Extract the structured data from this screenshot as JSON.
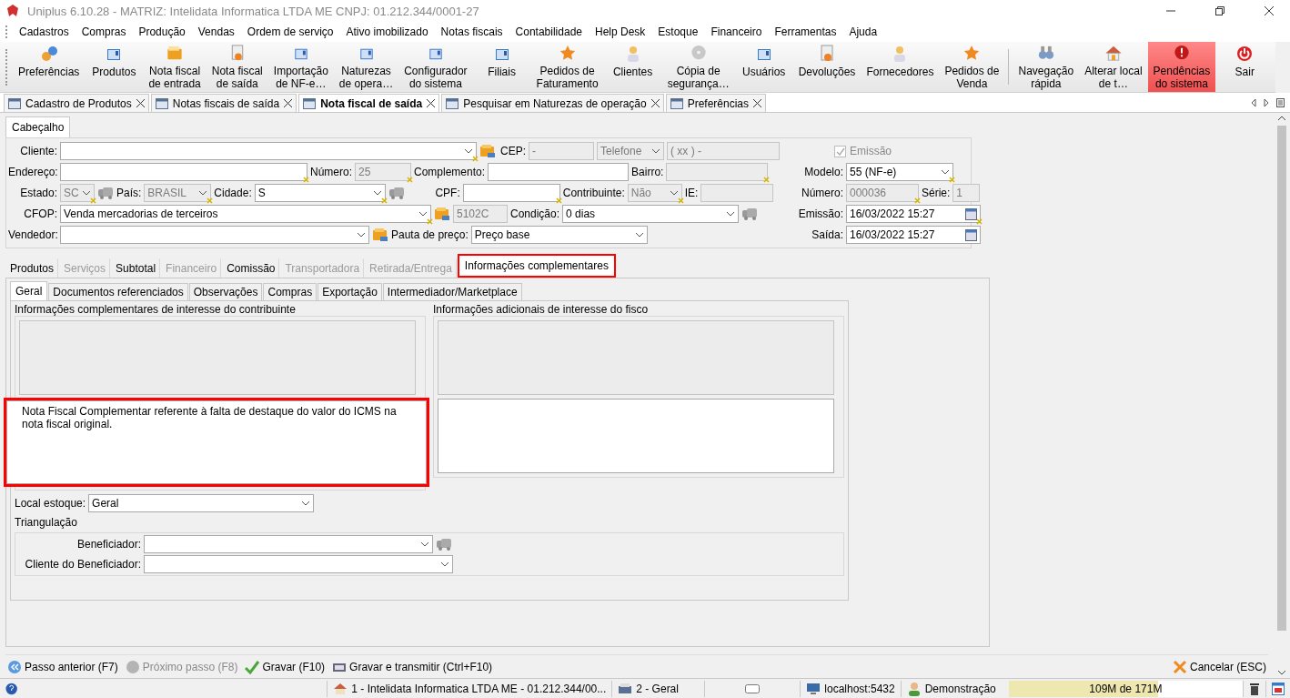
{
  "window": {
    "title": "Uniplus 6.10.28 - MATRIZ: Intelidata Informatica LTDA ME CNPJ: 01.212.344/0001-27"
  },
  "menu": [
    "Cadastros",
    "Compras",
    "Produção",
    "Vendas",
    "Ordem de serviço",
    "Ativo imobilizado",
    "Notas fiscais",
    "Contabilidade",
    "Help Desk",
    "Estoque",
    "Financeiro",
    "Ferramentas",
    "Ajuda"
  ],
  "toolbar": [
    [
      {
        "label": "Preferências",
        "kind": "gear"
      },
      {
        "label": "Produtos",
        "kind": "window"
      },
      {
        "label": "Nota fiscal\nde entrada",
        "kind": "folder"
      },
      {
        "label": "Nota fiscal\nde saída",
        "kind": "document"
      },
      {
        "label": "Importação\nde NF-e…",
        "kind": "window"
      },
      {
        "label": "Naturezas\nde opera…",
        "kind": "window"
      },
      {
        "label": "Configurador\ndo sistema",
        "kind": "window"
      },
      {
        "label": "Filiais",
        "kind": "window"
      },
      {
        "label": "Pedidos de\nFaturamento",
        "kind": "star"
      },
      {
        "label": "Clientes",
        "kind": "person"
      },
      {
        "label": "Cópia de\nsegurança…",
        "kind": "disc"
      },
      {
        "label": "Usuários",
        "kind": "window"
      },
      {
        "label": "Devoluções",
        "kind": "document"
      },
      {
        "label": "Fornecedores",
        "kind": "person"
      },
      {
        "label": "Pedidos de\nVenda",
        "kind": "star"
      }
    ],
    [
      {
        "label": "Navegação\nrápida",
        "kind": "binoculars"
      },
      {
        "label": "Alterar local\nde t…",
        "kind": "house"
      },
      {
        "label": "Pendências\ndo sistema",
        "kind": "alert"
      },
      {
        "label": "Sair",
        "kind": "power"
      }
    ]
  ],
  "doc_tabs": [
    {
      "label": "Cadastro de Produtos",
      "selected": false
    },
    {
      "label": "Notas fiscais de saída",
      "selected": false
    },
    {
      "label": "Nota fiscal de saída",
      "selected": true
    },
    {
      "label": "Pesquisar em Naturezas de operação",
      "selected": false
    },
    {
      "label": "Preferências",
      "selected": false
    }
  ],
  "header": {
    "tab": "Cabeçalho",
    "rows": [
      {
        "left": [
          {
            "kind": "label",
            "text": "Cliente:"
          },
          {
            "kind": "combo",
            "required": true
          },
          {
            "kind": "card"
          },
          {
            "kind": "label",
            "text": "CEP:"
          },
          {
            "kind": "text",
            "value": "-",
            "disabled": true
          },
          {
            "kind": "combo",
            "value": "Telefone",
            "disabled": true
          },
          {
            "kind": "text",
            "value": "( xx )   -",
            "disabled": true
          }
        ],
        "right": [
          {
            "kind": "checkbox",
            "text": "Emissão",
            "checked": true,
            "disabled": true
          }
        ]
      },
      {
        "left": [
          {
            "kind": "label",
            "text": "Endereço:"
          },
          {
            "kind": "text",
            "required": true
          },
          {
            "kind": "label",
            "text": "Número:"
          },
          {
            "kind": "text",
            "value": "25",
            "disabled": true,
            "required": true
          },
          {
            "kind": "label",
            "text": "Complemento:"
          },
          {
            "kind": "text"
          },
          {
            "kind": "label",
            "text": "Bairro:"
          },
          {
            "kind": "text",
            "disabled": true,
            "required": true
          }
        ],
        "right": [
          {
            "kind": "label",
            "text": "Modelo:"
          },
          {
            "kind": "combo",
            "value": "55  (NF-e)",
            "required": true
          }
        ]
      },
      {
        "left": [
          {
            "kind": "label",
            "text": "Estado:"
          },
          {
            "kind": "combo",
            "value": "SC",
            "disabled": true,
            "required": true
          },
          {
            "kind": "cars"
          },
          {
            "kind": "label",
            "text": "País:"
          },
          {
            "kind": "combo",
            "value": "BRASIL",
            "disabled": true,
            "required": true
          },
          {
            "kind": "label",
            "text": "Cidade:"
          },
          {
            "kind": "combo",
            "value": "S",
            "required": true
          },
          {
            "kind": "cars"
          },
          {
            "kind": "label",
            "text": "CPF:"
          },
          {
            "kind": "text",
            "required": true
          },
          {
            "kind": "label",
            "text": "Contribuinte:"
          },
          {
            "kind": "combo",
            "value": "Não",
            "disabled": true,
            "required": true
          },
          {
            "kind": "label",
            "text": "IE:"
          },
          {
            "kind": "text",
            "disabled": true
          }
        ],
        "right": [
          {
            "kind": "label",
            "text": "Número:"
          },
          {
            "kind": "text",
            "value": "000036",
            "disabled": true,
            "required": true
          },
          {
            "kind": "label",
            "text": "Série:"
          },
          {
            "kind": "text",
            "value": "1",
            "disabled": true
          }
        ]
      },
      {
        "left": [
          {
            "kind": "label",
            "text": "CFOP:"
          },
          {
            "kind": "combo",
            "value": "Venda mercadorias de terceiros",
            "required": true
          },
          {
            "kind": "card"
          },
          {
            "kind": "text",
            "value": "5102C",
            "disabled": true
          },
          {
            "kind": "label",
            "text": "Condição:"
          },
          {
            "kind": "combo",
            "value": "0 dias"
          },
          {
            "kind": "cars"
          }
        ],
        "right": [
          {
            "kind": "label",
            "text": "Emissão:"
          },
          {
            "kind": "date",
            "value": "16/03/2022 15:27",
            "required": true
          }
        ]
      },
      {
        "left": [
          {
            "kind": "label",
            "text": "Vendedor:"
          },
          {
            "kind": "combo"
          },
          {
            "kind": "card"
          },
          {
            "kind": "label",
            "text": "Pauta de preço:"
          },
          {
            "kind": "combo",
            "value": "Preço base"
          }
        ],
        "right": [
          {
            "kind": "label",
            "text": "Saída:"
          },
          {
            "kind": "date",
            "value": "16/03/2022 15:27"
          }
        ]
      }
    ]
  },
  "tabs": [
    {
      "label": "Produtos",
      "selected": false,
      "disabled": false
    },
    {
      "label": "Serviços",
      "selected": false,
      "disabled": true
    },
    {
      "label": "Subtotal",
      "selected": false,
      "disabled": false
    },
    {
      "label": "Financeiro",
      "selected": false,
      "disabled": true
    },
    {
      "label": "Comissão",
      "selected": false,
      "disabled": false
    },
    {
      "label": "Transportadora",
      "selected": false,
      "disabled": true
    },
    {
      "label": "Retirada/Entrega",
      "selected": false,
      "disabled": true
    },
    {
      "label": "Informações complementares",
      "selected": true,
      "disabled": false,
      "highlighted": true
    }
  ],
  "sub_tabs": [
    {
      "label": "Geral",
      "selected": true
    },
    {
      "label": "Documentos referenciados",
      "selected": false
    },
    {
      "label": "Observações",
      "selected": false
    },
    {
      "label": "Compras",
      "selected": false
    },
    {
      "label": "Exportação",
      "selected": false
    },
    {
      "label": "Intermediador/Marketplace",
      "selected": false
    }
  ],
  "info_groups": [
    {
      "title": "Informações complementares de interesse do contribuinte",
      "text": "Nota Fiscal Complementar referente à falta de destaque do valor do ICMS na nota fiscal original.",
      "highlighted": true
    },
    {
      "title": "Informações adicionais de interesse do fisco",
      "highlighted": false
    }
  ],
  "local_estoque": {
    "label": "Local estoque:",
    "value": "Geral"
  },
  "triangulacao": {
    "title": "Triangulação",
    "fields": [
      {
        "label": "Beneficiador:",
        "lookup": true
      },
      {
        "label": "Cliente do Beneficiador:",
        "lookup": false
      }
    ]
  },
  "actions": [
    {
      "label": "Passo anterior (F7)",
      "kind": "back",
      "disabled": false
    },
    {
      "label": "Próximo passo (F8)",
      "kind": "next",
      "disabled": true
    },
    {
      "label": "Gravar (F10)",
      "kind": "save",
      "disabled": false
    },
    {
      "label": "Gravar e transmitir (Ctrl+F10)",
      "kind": "transmit",
      "disabled": false
    }
  ],
  "cancel": {
    "label": "Cancelar (ESC)"
  },
  "status_bar": {
    "company": "1 - Intelidata Informatica LTDA ME - 01.212.344/00...",
    "stock": "2 - Geral",
    "server": "localhost:5432",
    "user": "Demonstração",
    "memory": {
      "text": "109M de 171M",
      "level": 0.64
    }
  }
}
